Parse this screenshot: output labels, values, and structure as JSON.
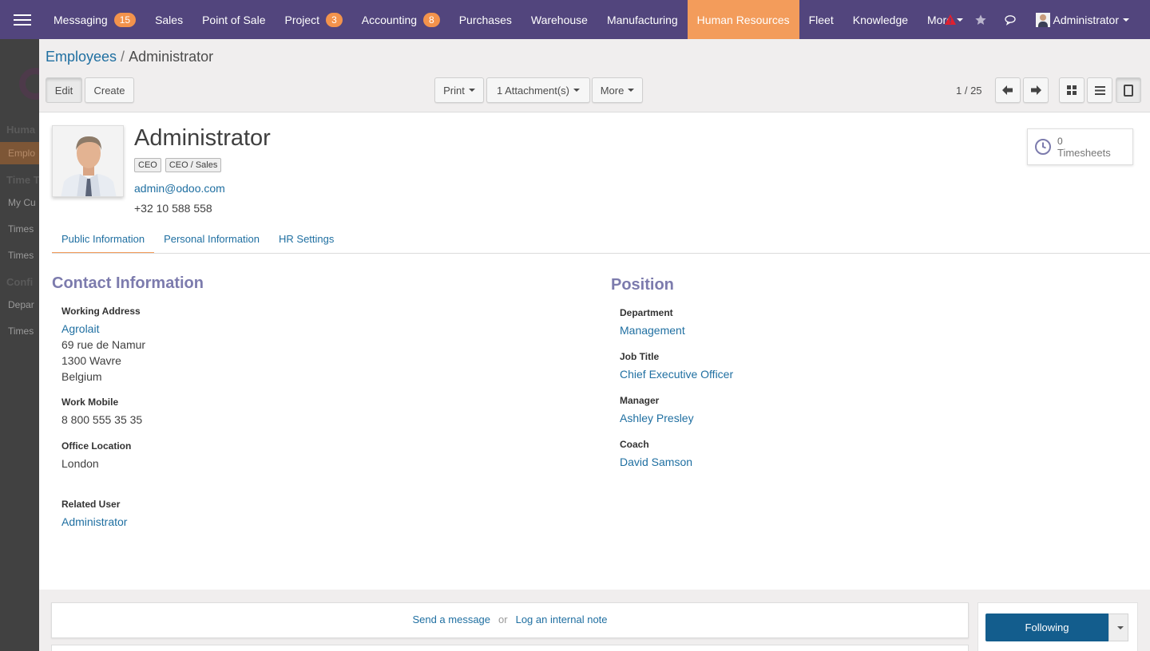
{
  "topbar": {
    "menu": [
      {
        "label": "Messaging",
        "badge": "15"
      },
      {
        "label": "Sales",
        "badge": ""
      },
      {
        "label": "Point of Sale",
        "badge": ""
      },
      {
        "label": "Project",
        "badge": "3"
      },
      {
        "label": "Accounting",
        "badge": "8"
      },
      {
        "label": "Purchases",
        "badge": ""
      },
      {
        "label": "Warehouse",
        "badge": ""
      },
      {
        "label": "Manufacturing",
        "badge": ""
      },
      {
        "label": "Human Resources",
        "badge": "",
        "active": true
      },
      {
        "label": "Fleet",
        "badge": ""
      },
      {
        "label": "Knowledge",
        "badge": ""
      },
      {
        "label": "More",
        "badge": ""
      }
    ],
    "user_name": "Administrator",
    "colors": {
      "bar": "#52457d",
      "active": "#f39c5b",
      "badge": "#f3934c",
      "alert": "#e0202f"
    }
  },
  "sidebar": {
    "items": [
      "Huma",
      "Emplo",
      "Time T",
      "My Cu",
      "Times",
      "Times",
      "Confi",
      "Depar",
      "Times"
    ]
  },
  "control": {
    "breadcrumb_parent": "Employees",
    "breadcrumb_sep": "/",
    "breadcrumb_current": "Administrator",
    "edit_label": "Edit",
    "create_label": "Create",
    "print_label": "Print",
    "attachments_label": "1 Attachment(s)",
    "more_label": "More",
    "pager": "1 / 25"
  },
  "employee": {
    "name": "Administrator",
    "tags": [
      "CEO",
      "CEO / Sales"
    ],
    "email": "admin@odoo.com",
    "phone": "+32 10 588 558",
    "timesheets_count": "0",
    "timesheets_label": "Timesheets"
  },
  "tabs": [
    "Public Information",
    "Personal Information",
    "HR Settings"
  ],
  "contact": {
    "title": "Contact Information",
    "working_address_label": "Working Address",
    "company": "Agrolait",
    "street": "69 rue de Namur",
    "city": "1300 Wavre",
    "country": "Belgium",
    "work_mobile_label": "Work Mobile",
    "work_mobile": "8 800 555 35 35",
    "office_location_label": "Office Location",
    "office_location": "London",
    "related_user_label": "Related User",
    "related_user": "Administrator"
  },
  "position": {
    "title": "Position",
    "department_label": "Department",
    "department": "Management",
    "job_title_label": "Job Title",
    "job_title": "Chief Executive Officer",
    "manager_label": "Manager",
    "manager": "Ashley Presley",
    "coach_label": "Coach",
    "coach": "David Samson"
  },
  "chatter": {
    "send_message": "Send a message",
    "or": "or",
    "log_note": "Log an internal note",
    "following": "Following"
  }
}
